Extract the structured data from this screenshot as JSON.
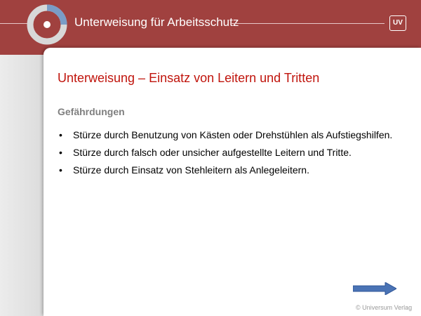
{
  "header": {
    "title": "Unterweisung für Arbeitsschutz",
    "badge": "UV",
    "logo_icon": "circle-logo-icon"
  },
  "slide": {
    "title": "Unterweisung – Einsatz von Leitern und Tritten",
    "section_heading": "Gefährdungen",
    "bullets": [
      "Stürze durch Benutzung von Kästen oder Drehstühlen als Aufstiegshilfen.",
      "Stürze durch falsch oder unsicher aufgestellte Leitern und Tritte.",
      "Stürze durch Einsatz von Stehleitern als Anlegeleitern."
    ],
    "bullet_symbol": "•"
  },
  "navigation": {
    "next_icon": "arrow-right-icon"
  },
  "footer": {
    "copyright": "© Universum Verlag"
  },
  "colors": {
    "header_bg": "#a0413f",
    "title_red": "#c0140c",
    "heading_gray": "#7f7f7f",
    "arrow_blue": "#4a73b5"
  }
}
